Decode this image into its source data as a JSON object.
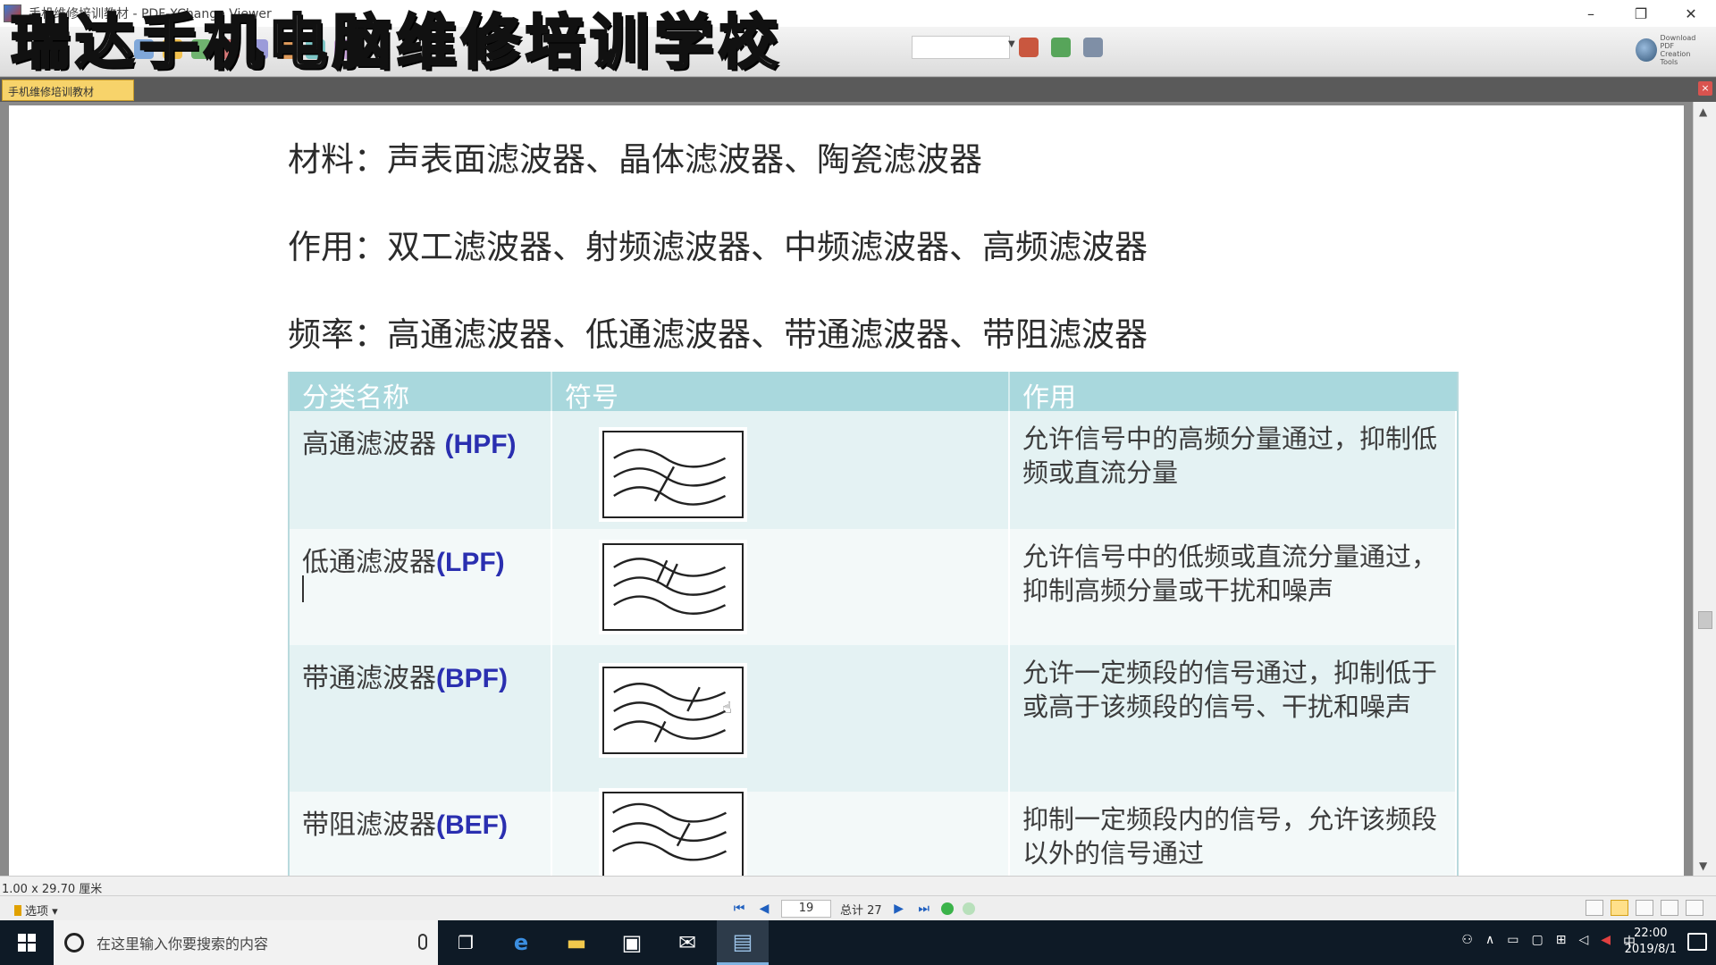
{
  "window": {
    "title": "手机维修培训教材 - PDF-XChange Viewer",
    "minimize": "–",
    "restore": "❐",
    "close": "✕"
  },
  "watermark": "瑞达手机电脑维修培训学校",
  "toolbar": {
    "download_line1": "Download PDF",
    "download_line2": "Creation Tools"
  },
  "tab": {
    "label": "手机维修培训教材",
    "close": "×"
  },
  "document": {
    "line1": "材料：声表面滤波器、晶体滤波器、陶瓷滤波器",
    "line2": "作用：双工滤波器、射频滤波器、中频滤波器、高频滤波器",
    "line3": "频率：高通滤波器、低通滤波器、带通滤波器、带阻滤波器",
    "table": {
      "headers": [
        "分类名称",
        "符号",
        "作用"
      ],
      "rows": [
        {
          "name": "高通滤波器 ",
          "abbr": "(HPF)",
          "desc": "允许信号中的高频分量通过，抑制低频或直流分量"
        },
        {
          "name": "低通滤波器",
          "abbr": "(LPF)",
          "desc": "允许信号中的低频或直流分量通过，抑制高频分量或干扰和噪声"
        },
        {
          "name": "带通滤波器",
          "abbr": "(BPF)",
          "desc": "允许一定频段的信号通过，抑制低于或高于该频段的信号、干扰和噪声"
        },
        {
          "name": "带阻滤波器",
          "abbr": "(BEF)",
          "desc": "抑制一定频段内的信号，允许该频段以外的信号通过"
        }
      ]
    }
  },
  "status": {
    "page_size": "1.00 x 29.70 厘米",
    "options": "选项",
    "current_page": "19",
    "total": "总计 27"
  },
  "taskbar": {
    "search_placeholder": "在这里输入你要搜索的内容",
    "ime": "中",
    "time": "22:00",
    "date": "2019/8/1"
  }
}
